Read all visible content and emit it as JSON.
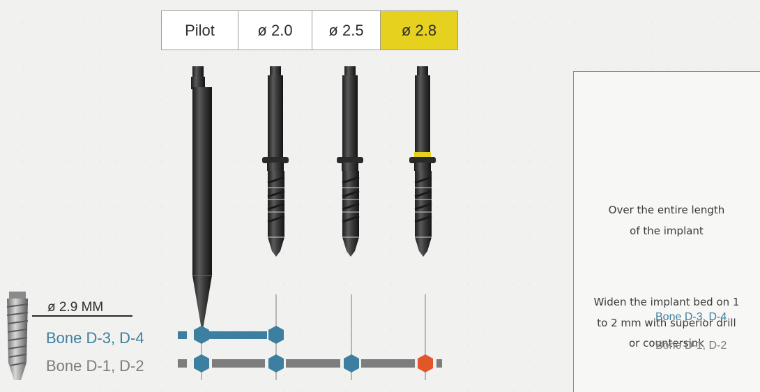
{
  "tabs": [
    {
      "label": "Pilot",
      "selected": false
    },
    {
      "label": "ø  2.0",
      "selected": false
    },
    {
      "label": "ø  2.5",
      "selected": false
    },
    {
      "label": "ø  2.8",
      "selected": true
    }
  ],
  "implant": {
    "diameter_label": "ø  2.9 MM"
  },
  "rows": {
    "bone_d34": {
      "label": "Bone D-3, D-4",
      "color": "#3d7fa0"
    },
    "bone_d12": {
      "label": "Bone D-1, D-2",
      "color": "#7d7d7d"
    }
  },
  "panel": {
    "blue_marker_text_1": "Over the entire length",
    "blue_marker_text_2": "of the implant",
    "orange_marker_text_1": "Widen the implant bed on 1",
    "orange_marker_text_2": "to 2 mm with superior drill",
    "orange_marker_text_3": "or countersink",
    "legend_d34": "Bone D-3, D-4",
    "legend_d12": "Bone D-1, D-2"
  },
  "colors": {
    "accent_yellow": "#e6d21e",
    "marker_blue": "#3d7fa0",
    "marker_orange": "#e2572a",
    "bar_gray": "#7d7d7d",
    "divider_navy": "#1f2f5c"
  }
}
